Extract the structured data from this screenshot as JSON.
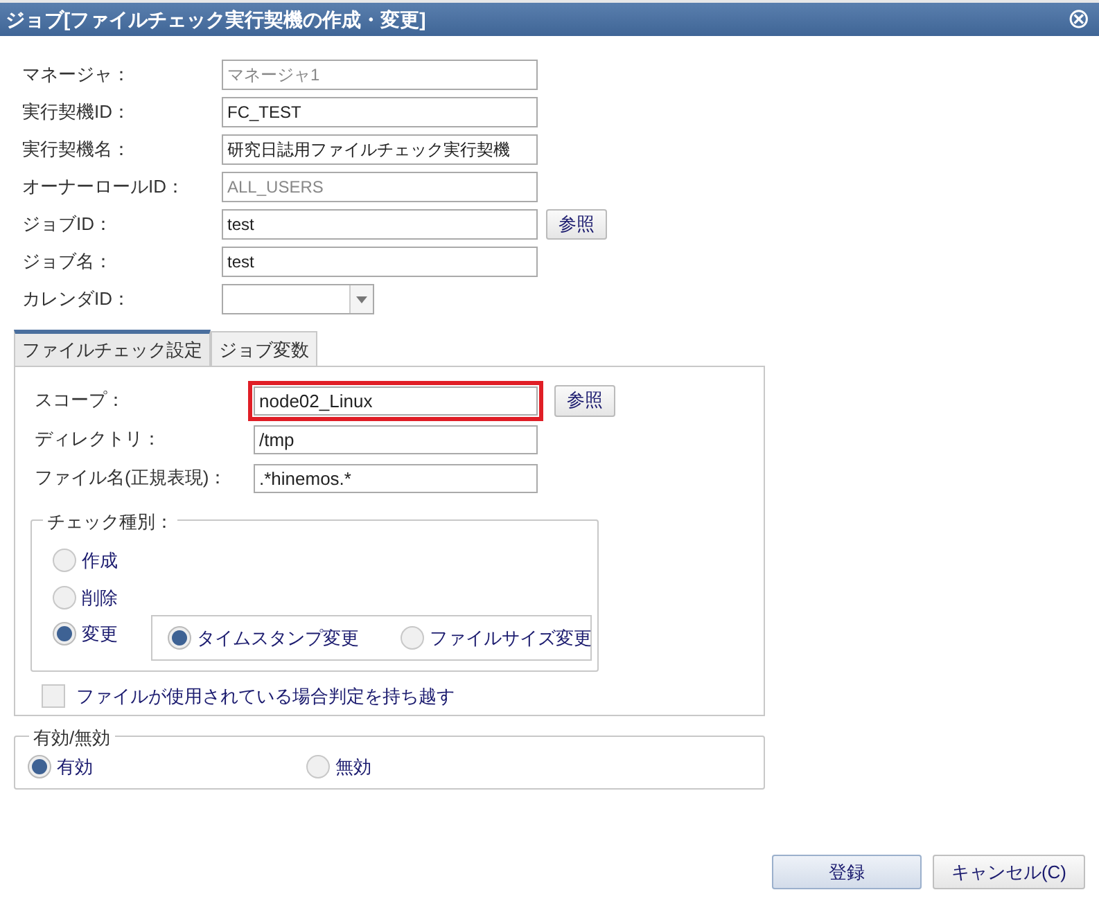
{
  "window": {
    "title": "ジョブ[ファイルチェック実行契機の作成・変更]",
    "close": "⊗"
  },
  "fields": [
    {
      "label": "マネージャ：",
      "value": "マネージャ1",
      "kind": "text",
      "disabled": true
    },
    {
      "label": "実行契機ID：",
      "value": "FC_TEST",
      "kind": "text",
      "disabled": false
    },
    {
      "label": "実行契機名：",
      "value": "研究日誌用ファイルチェック実行契機",
      "kind": "text",
      "disabled": false
    },
    {
      "label": "オーナーロールID：",
      "value": "ALL_USERS",
      "kind": "text",
      "disabled": true
    },
    {
      "label": "ジョブID：",
      "value": "test",
      "kind": "text",
      "disabled": false,
      "button": "参照"
    },
    {
      "label": "ジョブ名：",
      "value": "test",
      "kind": "text",
      "disabled": false
    },
    {
      "label": "カレンダID：",
      "kind": "combo",
      "disabled": false
    }
  ],
  "tabs": [
    {
      "label": "ファイルチェック設定",
      "selected": true
    },
    {
      "label": "ジョブ変数",
      "selected": false
    }
  ],
  "tab_fields": [
    {
      "label": "スコープ：",
      "value": "node02_Linux",
      "highlighted": true,
      "button": "参照"
    },
    {
      "label": "ディレクトリ：",
      "value": "/tmp",
      "highlighted": false
    },
    {
      "label": "ファイル名(正規表現)：",
      "value": ".*hinemos.*",
      "highlighted": false
    }
  ],
  "check_type": {
    "legend": "チェック種別：",
    "options": [
      {
        "label": "作成",
        "selected": false
      },
      {
        "label": "削除",
        "selected": false
      },
      {
        "label": "変更",
        "selected": true
      }
    ],
    "change_options": [
      {
        "label": "タイムスタンプ変更",
        "selected": true
      },
      {
        "label": "ファイルサイズ変更",
        "selected": false
      }
    ]
  },
  "carry_over": {
    "label": "ファイルが使用されている場合判定を持ち越す",
    "checked": false
  },
  "validity": {
    "legend": "有効/無効",
    "options": [
      {
        "label": "有効",
        "selected": true
      },
      {
        "label": "無効",
        "selected": false
      }
    ]
  },
  "buttons": [
    {
      "label": "登録",
      "kind": "primary"
    },
    {
      "label": "キャンセル(C)",
      "kind": "secondary"
    }
  ]
}
